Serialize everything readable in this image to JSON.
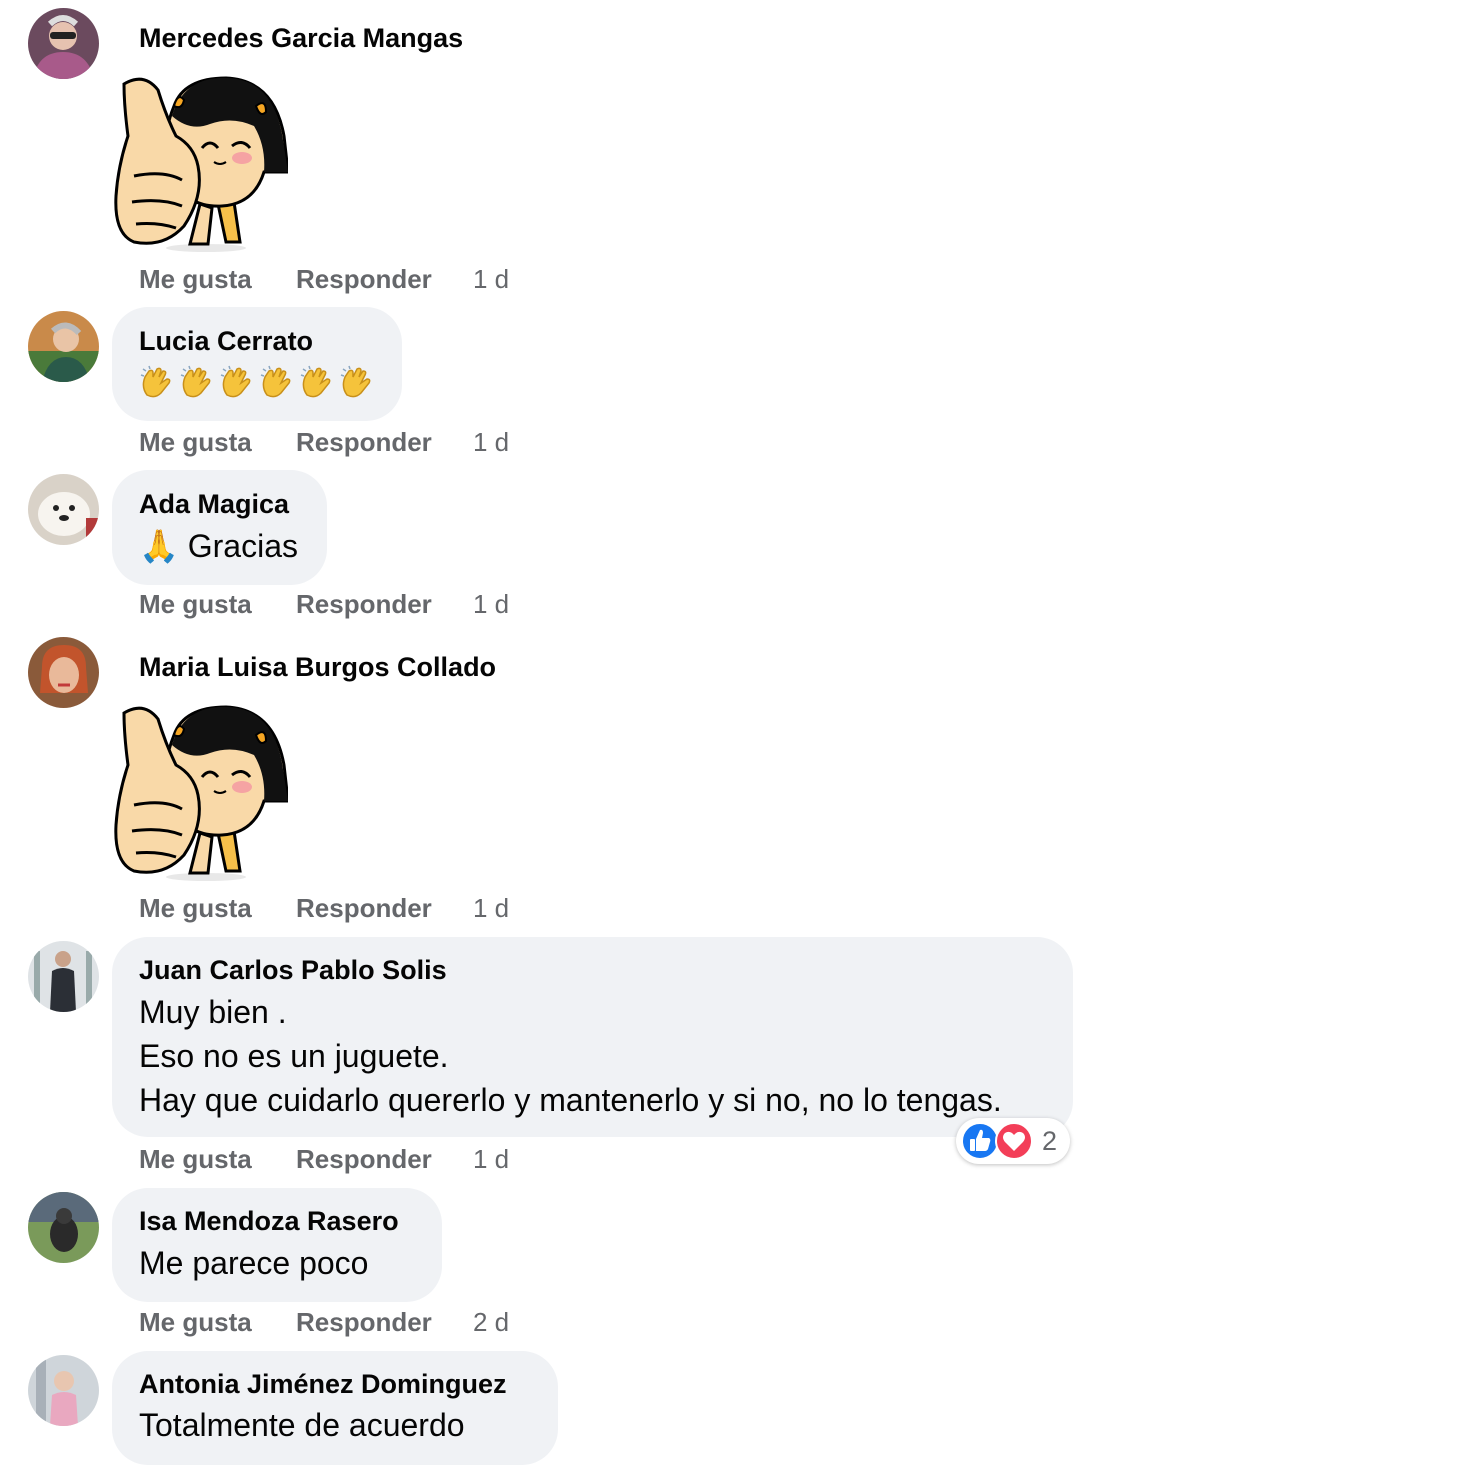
{
  "actions": {
    "like_label": "Me gusta",
    "reply_label": "Responder"
  },
  "comments": [
    {
      "author": "Mercedes Garcia Mangas",
      "text": "",
      "sticker": "thumbs-up-girl-sticker",
      "time": "1 d"
    },
    {
      "author": "Lucia Cerrato",
      "text": "",
      "emojis": [
        "clap",
        "clap",
        "clap",
        "clap",
        "clap",
        "clap"
      ],
      "time": "1 d"
    },
    {
      "author": "Ada Magica",
      "text": "🙏 Gracias",
      "time": "1 d"
    },
    {
      "author": "Maria Luisa Burgos Collado",
      "text": "",
      "sticker": "thumbs-up-girl-sticker",
      "time": "1 d"
    },
    {
      "author": "Juan Carlos Pablo Solis",
      "lines": [
        "Muy bien .",
        "Eso no es un juguete.",
        "Hay que cuidarlo quererlo y mantenerlo y si no, no lo tengas."
      ],
      "time": "1 d",
      "reactions": {
        "icons": [
          "like-icon",
          "heart-icon"
        ],
        "count": "2"
      }
    },
    {
      "author": "Isa Mendoza Rasero",
      "text": "Me parece poco",
      "time": "2 d"
    },
    {
      "author": "Antonia Jiménez Dominguez",
      "text": "Totalmente de acuerdo"
    }
  ],
  "colors": {
    "bubble": "#f0f2f5",
    "meta": "#65676b",
    "like_blue": "#1877f2",
    "love_red": "#f33e58"
  }
}
